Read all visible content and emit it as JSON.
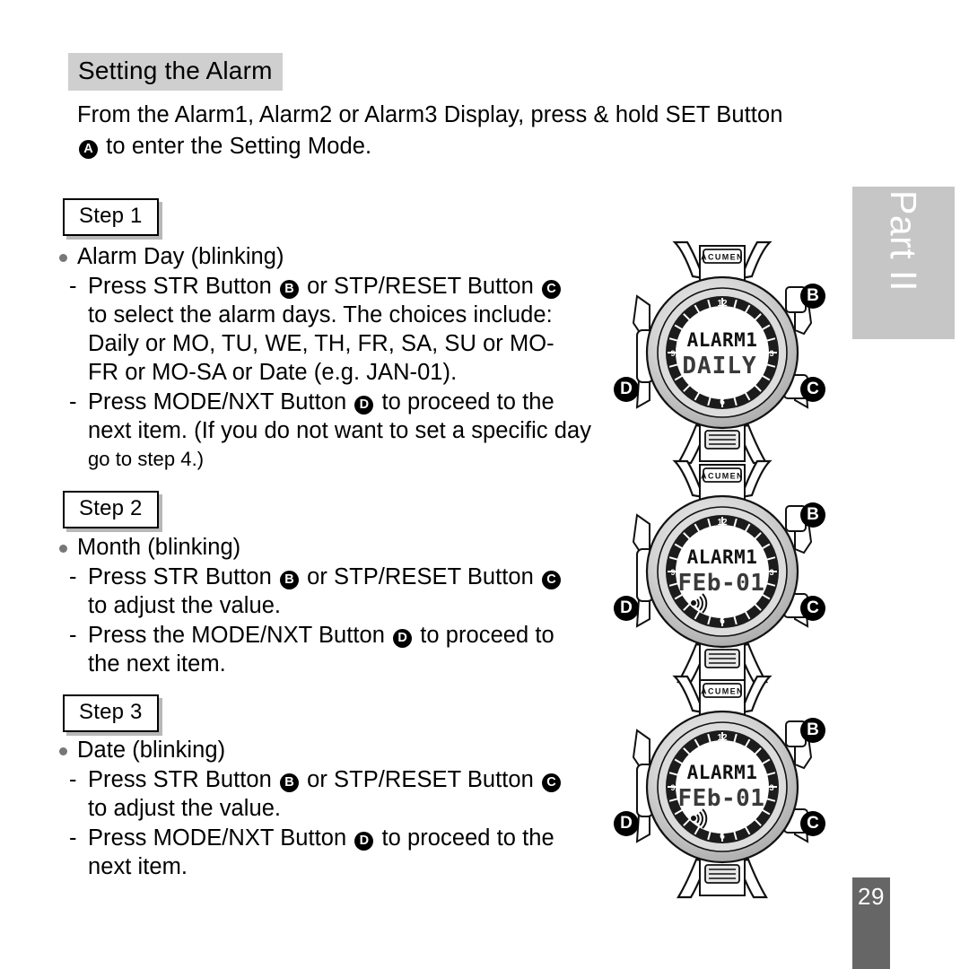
{
  "page": {
    "number": "29",
    "part_label": "Part II",
    "section_heading": "Setting the Alarm"
  },
  "intro": {
    "line1": "From the Alarm1, Alarm2 or Alarm3 Display, press & hold SET Button",
    "badge_a": "A",
    "line2_rest": " to enter the Setting Mode."
  },
  "steps": [
    {
      "box_label": "Step 1",
      "bullet": "Alarm Day (blinking)",
      "items": [
        {
          "dash": "-",
          "lines": [
            {
              "pre": "Press STR Button ",
              "badge1": "B",
              "mid": " or STP/RESET Button ",
              "badge2": "C",
              "post": ""
            },
            {
              "pre": "to select the alarm days. The choices include:"
            },
            {
              "pre": "Daily or MO, TU, WE, TH, FR, SA, SU or MO-"
            },
            {
              "pre": "FR or MO-SA or Date (e.g. JAN-01)."
            }
          ]
        },
        {
          "dash": "-",
          "lines": [
            {
              "pre": "Press MODE/NXT Button ",
              "badge1": "D",
              "mid": " to proceed to the",
              "post": ""
            },
            {
              "pre": "next item. (If you do not want to set a specific day"
            },
            {
              "pre": "go to step 4.)",
              "small": true
            }
          ]
        }
      ]
    },
    {
      "box_label": "Step 2",
      "bullet": "Month (blinking)",
      "items": [
        {
          "dash": "-",
          "lines": [
            {
              "pre": "Press STR Button ",
              "badge1": "B",
              "mid": " or STP/RESET Button ",
              "badge2": "C",
              "post": ""
            },
            {
              "pre": "to adjust the value."
            }
          ]
        },
        {
          "dash": "-",
          "lines": [
            {
              "pre": "Press the MODE/NXT Button ",
              "badge1": "D",
              "mid": " to proceed to",
              "post": ""
            },
            {
              "pre": "the next item."
            }
          ]
        }
      ]
    },
    {
      "box_label": "Step 3",
      "bullet": "Date (blinking)",
      "items": [
        {
          "dash": "-",
          "lines": [
            {
              "pre": "Press STR Button ",
              "badge1": "B",
              "mid": " or STP/RESET Button ",
              "badge2": "C",
              "post": ""
            },
            {
              "pre": "to adjust the value."
            }
          ]
        },
        {
          "dash": "-",
          "lines": [
            {
              "pre": "Press MODE/NXT Button ",
              "badge1": "D",
              "mid": " to proceed to the",
              "post": ""
            },
            {
              "pre": "next item."
            }
          ]
        }
      ]
    }
  ],
  "watches": [
    {
      "brand": "ACUMEN",
      "lcd_line1": "ALARM1",
      "lcd_line2": "DAILY",
      "bell_icon": false,
      "bezel_top": "12",
      "bezel_bottom": "6",
      "bezel_left": "9",
      "bezel_right": "3",
      "badge_top_right": "B",
      "badge_bottom_right": "C",
      "badge_bottom_left": "D"
    },
    {
      "brand": "ACUMEN",
      "lcd_line1": "ALARM1",
      "lcd_line2": "FEb-01",
      "bell_icon": true,
      "bezel_top": "12",
      "bezel_bottom": "6",
      "bezel_left": "9",
      "bezel_right": "3",
      "badge_top_right": "B",
      "badge_bottom_right": "C",
      "badge_bottom_left": "D"
    },
    {
      "brand": "ACUMEN",
      "lcd_line1": "ALARM1",
      "lcd_line2": "FEb-01",
      "bell_icon": true,
      "bezel_top": "12",
      "bezel_bottom": "6",
      "bezel_left": "9",
      "bezel_right": "3",
      "badge_top_right": "B",
      "badge_bottom_right": "C",
      "badge_bottom_left": "D"
    }
  ],
  "colors": {
    "heading_bg": "#cfcfcf",
    "part_rail_bg": "#c6c6c6",
    "page_bar_bg": "#666666",
    "bullet_dot": "#777777",
    "badge_bg": "#000000"
  }
}
